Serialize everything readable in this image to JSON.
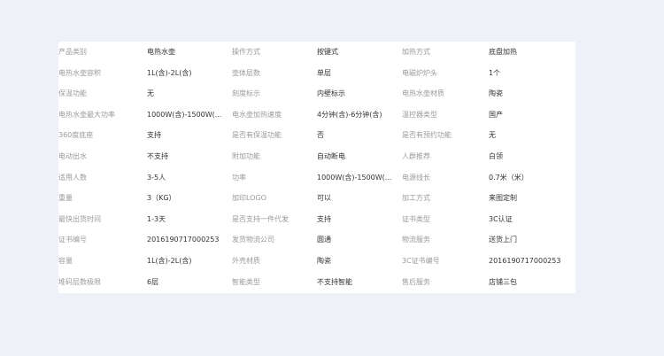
{
  "spec_rows": [
    {
      "k1": "产品类别",
      "v1": "电热水壶",
      "k2": "操作方式",
      "v2": "按键式",
      "k3": "加热方式",
      "v3": "底盘加热"
    },
    {
      "k1": "电热水壶容积",
      "v1": "1L(含)-2L(含)",
      "k2": "壶体层数",
      "v2": "单层",
      "k3": "电磁炉炉头",
      "v3": "1个"
    },
    {
      "k1": "保温功能",
      "v1": "无",
      "k2": "刻度标示",
      "v2": "内壁标示",
      "k3": "电热水壶材质",
      "v3": "陶瓷"
    },
    {
      "k1": "电热水壶最大功率",
      "v1": "1000W(含)-1500W(...",
      "k2": "电水壶加热速度",
      "v2": "4分钟(含)-6分钟(含)",
      "k3": "温控器类型",
      "v3": "国产"
    },
    {
      "k1": "360度底座",
      "v1": "支持",
      "k2": "是否有保温功能",
      "v2": "否",
      "k3": "是否有预约功能",
      "v3": "无"
    },
    {
      "k1": "电动出水",
      "v1": "不支持",
      "k2": "附加功能",
      "v2": "自动断电",
      "k3": "人群推荐",
      "v3": "白领"
    },
    {
      "k1": "适用人数",
      "v1": "3-5人",
      "k2": "功率",
      "v2": "1000W(含)-1500W(...",
      "k3": "电源线长",
      "v3": "0.7米（米）"
    },
    {
      "k1": "重量",
      "v1": "3（KG）",
      "k2": "加印LOGO",
      "v2": "可以",
      "k3": "加工方式",
      "v3": "来图定制"
    },
    {
      "k1": "最快出货时间",
      "v1": "1-3天",
      "k2": "是否支持一件代发",
      "v2": "支持",
      "k3": "证书类型",
      "v3": "3C认证"
    },
    {
      "k1": "证书编号",
      "v1": "2016190717000253",
      "k2": "发货物流公司",
      "v2": "圆通",
      "k3": "物流服务",
      "v3": "送货上门"
    },
    {
      "k1": "容量",
      "v1": "1L(含)-2L(含)",
      "k2": "外壳材质",
      "v2": "陶瓷",
      "k3": "3C证书编号",
      "v3": "2016190717000253"
    },
    {
      "k1": "堆码层数极限",
      "v1": "6层",
      "k2": "智能类型",
      "v2": "不支持智能",
      "k3": "售后服务",
      "v3": "店铺三包"
    }
  ]
}
